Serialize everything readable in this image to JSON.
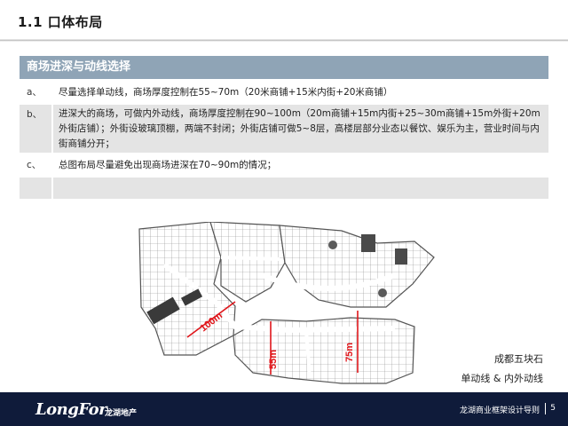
{
  "header": {
    "title": "1.1 口体布局"
  },
  "panel": {
    "heading": "商场进深与动线选择",
    "rows": [
      {
        "index": "a、",
        "text": "尽量选择单动线，商场厚度控制在55~70m（20米商铺+15米内街+20米商铺）"
      },
      {
        "index": "b、",
        "text": "进深大的商场，可做内外动线，商场厚度控制在90~100m（20m商铺+15m内街+25~30m商铺+15m外街+20m外街店铺）；外街设玻璃顶棚，两端不封闭；外街店铺可做5~8层，高楼层部分业态以餐饮、娱乐为主，营业时间与内街商铺分开；"
      },
      {
        "index": "c、",
        "text": "总图布局尽量避免出现商场进深在70~90m的情况；"
      },
      {
        "index": "",
        "text": ""
      }
    ]
  },
  "plan": {
    "dimensions": [
      "100m",
      "55m",
      "75m"
    ],
    "accent_color": "#e0161b"
  },
  "captions": {
    "place": "成都五块石",
    "note": "单动线 & 内外动线"
  },
  "footer": {
    "logo": "LongFor",
    "logo_cn": "龙湖地产",
    "doc_title": "龙湖商业框架设计导则",
    "page": "5"
  }
}
